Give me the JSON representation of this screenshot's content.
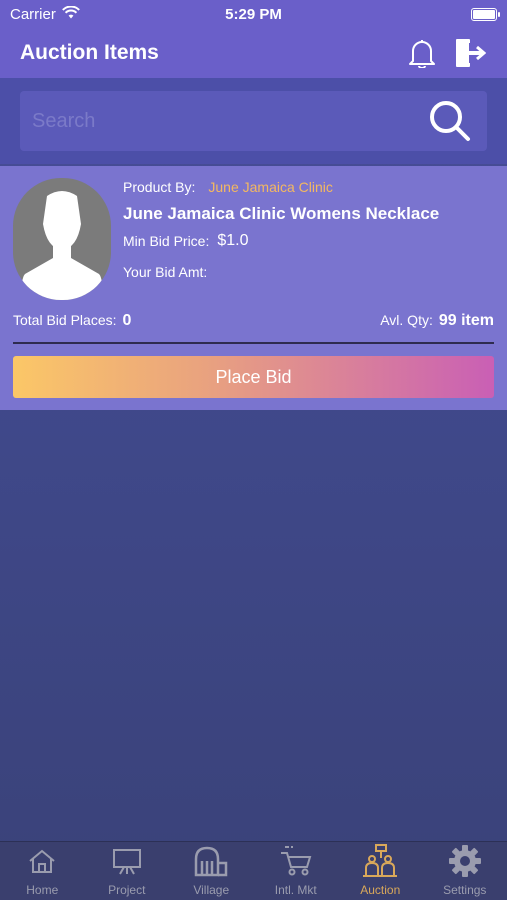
{
  "status_bar": {
    "carrier": "Carrier",
    "time": "5:29 PM"
  },
  "header": {
    "title": "Auction Items",
    "icons": [
      "bell-icon",
      "logout-icon"
    ]
  },
  "search": {
    "placeholder": "Search",
    "value": ""
  },
  "product": {
    "by_label": "Product By:",
    "by_value": "June Jamaica Clinic",
    "name": "June Jamaica Clinic Womens Necklace",
    "min_bid_label": "Min Bid Price:",
    "min_bid_value": "$1.0",
    "your_bid_label": "Your Bid Amt:",
    "total_bid_label": "Total Bid Places:",
    "total_bid_value": "0",
    "avl_qty_label": "Avl. Qty:",
    "avl_qty_value": "99 item",
    "place_bid_label": "Place Bid"
  },
  "tabs": [
    {
      "label": "Home",
      "icon": "home-icon",
      "active": false
    },
    {
      "label": "Project",
      "icon": "project-icon",
      "active": false
    },
    {
      "label": "Village",
      "icon": "village-icon",
      "active": false
    },
    {
      "label": "Intl. Mkt",
      "icon": "cart-icon",
      "active": false
    },
    {
      "label": "Auction",
      "icon": "auction-icon",
      "active": true
    },
    {
      "label": "Settings",
      "icon": "gear-icon",
      "active": false
    }
  ],
  "colors": {
    "accent": "#d9a85a",
    "header": "#6a5fc9",
    "card": "#7a74cf",
    "by_value": "#f4b860"
  }
}
